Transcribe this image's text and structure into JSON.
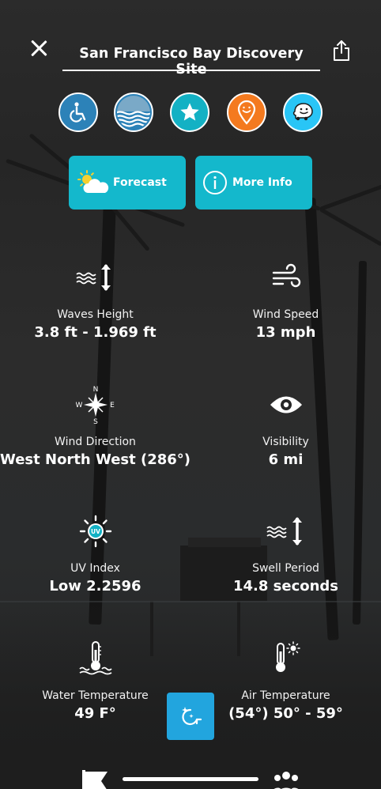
{
  "header": {
    "title": "San Francisco Bay Discovery Site"
  },
  "icons": {
    "close": "close-icon",
    "share": "share-icon",
    "amenities": [
      {
        "name": "accessible-icon",
        "color": "#2c82b8"
      },
      {
        "name": "water-quality-icon",
        "color": "#2c82b8"
      },
      {
        "name": "favorite-star-icon",
        "color": "#13b1c4"
      },
      {
        "name": "map-pin-icon",
        "color": "#f47a1f"
      },
      {
        "name": "waze-icon",
        "color": "#29c5f6"
      }
    ]
  },
  "actions": {
    "forecast_label": "Forecast",
    "more_info_label": "More Info",
    "color": "#14b8cc"
  },
  "metrics": {
    "waves_height": {
      "label": "Waves Height",
      "value": "3.8 ft - 1.969 ft"
    },
    "wind_speed": {
      "label": "Wind Speed",
      "value": "13 mph"
    },
    "wind_direction": {
      "label": "Wind Direction",
      "value": "West North West (286°)"
    },
    "visibility": {
      "label": "Visibility",
      "value": "6 mi"
    },
    "uv_index": {
      "label": "UV Index",
      "value": "Low 2.2596"
    },
    "swell_period": {
      "label": "Swell Period",
      "value": "14.8 seconds"
    },
    "water_temperature": {
      "label": "Water Temperature",
      "value": "49 F°"
    },
    "air_temperature": {
      "label": "Air Temperature",
      "value": "(54°) 50° - 59°"
    }
  },
  "refresh": {
    "color": "#22a5de"
  },
  "compass_letters": {
    "n": "N",
    "e": "E",
    "s": "S",
    "w": "W"
  },
  "uv_badge": "UV"
}
